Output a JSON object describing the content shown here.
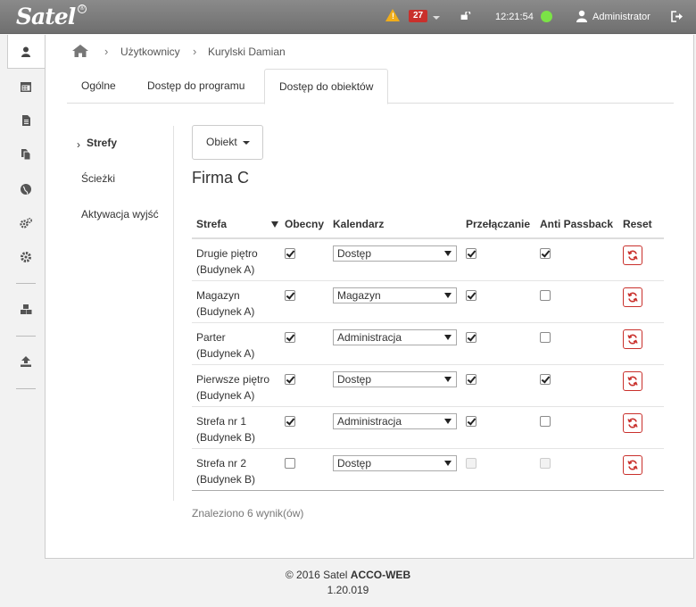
{
  "topbar": {
    "logo": "Satel",
    "logo_mark": "®",
    "alarm_icon": "warning-icon",
    "alarm_count": "27",
    "lock_icon": "unlock-icon",
    "clock": "12:21:54",
    "status_color": "#7be346",
    "user_icon": "user-icon",
    "user_name": "Administrator",
    "logout_icon": "logout-icon"
  },
  "sidebar": {
    "items": [
      "user-icon",
      "calendar-icon",
      "document-icon",
      "copy-icon",
      "globe-icon",
      "cogs-icon",
      "gear-icon",
      "cubes-icon",
      "upload-icon"
    ]
  },
  "breadcrumb": {
    "home_icon": "home-icon",
    "items": [
      "Użytkownicy",
      "Kurylski Damian"
    ]
  },
  "tabs": [
    {
      "label": "Ogólne"
    },
    {
      "label": "Dostęp do programu"
    },
    {
      "label": "Dostęp do obiektów"
    }
  ],
  "subnav": [
    {
      "label": "Strefy"
    },
    {
      "label": "Ścieżki"
    },
    {
      "label": "Aktywacja wyjść"
    }
  ],
  "object_button": "Obiekt",
  "object_title": "Firma C",
  "table": {
    "headers": [
      "Strefa",
      "Obecny",
      "Kalendarz",
      "Przełączanie",
      "Anti Passback",
      "Reset"
    ],
    "rows": [
      {
        "zone": "Drugie piętro",
        "building": "(Budynek A)",
        "present": true,
        "calendar": "Dostęp",
        "switching": true,
        "switching_disabled": false,
        "antipassback": true,
        "antipassback_disabled": false
      },
      {
        "zone": "Magazyn",
        "building": "(Budynek A)",
        "present": true,
        "calendar": "Magazyn",
        "switching": true,
        "switching_disabled": false,
        "antipassback": false,
        "antipassback_disabled": false
      },
      {
        "zone": "Parter",
        "building": "(Budynek A)",
        "present": true,
        "calendar": "Administracja",
        "switching": true,
        "switching_disabled": false,
        "antipassback": false,
        "antipassback_disabled": false
      },
      {
        "zone": "Pierwsze piętro",
        "building": "(Budynek A)",
        "present": true,
        "calendar": "Dostęp",
        "switching": true,
        "switching_disabled": false,
        "antipassback": true,
        "antipassback_disabled": false
      },
      {
        "zone": "Strefa nr 1",
        "building": "(Budynek B)",
        "present": true,
        "calendar": "Administracja",
        "switching": true,
        "switching_disabled": false,
        "antipassback": false,
        "antipassback_disabled": false
      },
      {
        "zone": "Strefa nr 2",
        "building": "(Budynek B)",
        "present": false,
        "calendar": "Dostęp",
        "switching": false,
        "switching_disabled": true,
        "antipassback": false,
        "antipassback_disabled": true
      }
    ]
  },
  "found_text": "Znaleziono 6 wynik(ów)",
  "footer": {
    "copyright": "© 2016 Satel",
    "product": "ACCO-WEB",
    "version": "1.20.019"
  },
  "colors": {
    "topbar": "#7c7c7c",
    "accent_red": "#c9302c",
    "status_green": "#7be346",
    "warning": "#f0ad1a"
  }
}
